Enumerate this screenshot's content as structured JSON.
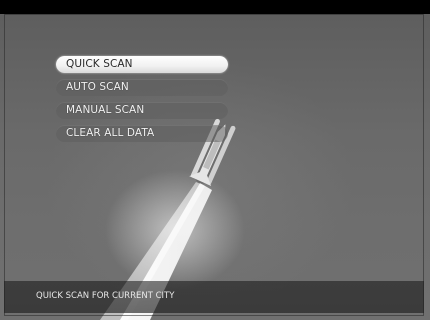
{
  "menu": {
    "items": [
      {
        "label": "QUICK SCAN",
        "selected": true
      },
      {
        "label": "AUTO SCAN",
        "selected": false
      },
      {
        "label": "MANUAL SCAN",
        "selected": false
      },
      {
        "label": "CLEAR ALL DATA",
        "selected": false
      }
    ]
  },
  "status": {
    "text": "QUICK SCAN FOR CURRENT CITY"
  },
  "background": {
    "image": "space-shuttle-launch"
  },
  "colors": {
    "selected_item_bg": "#ffffff",
    "selected_item_text": "#2a2a2a",
    "item_bg": "#5f5f5f",
    "item_text": "#f2f2f2",
    "sky": "#666666"
  }
}
